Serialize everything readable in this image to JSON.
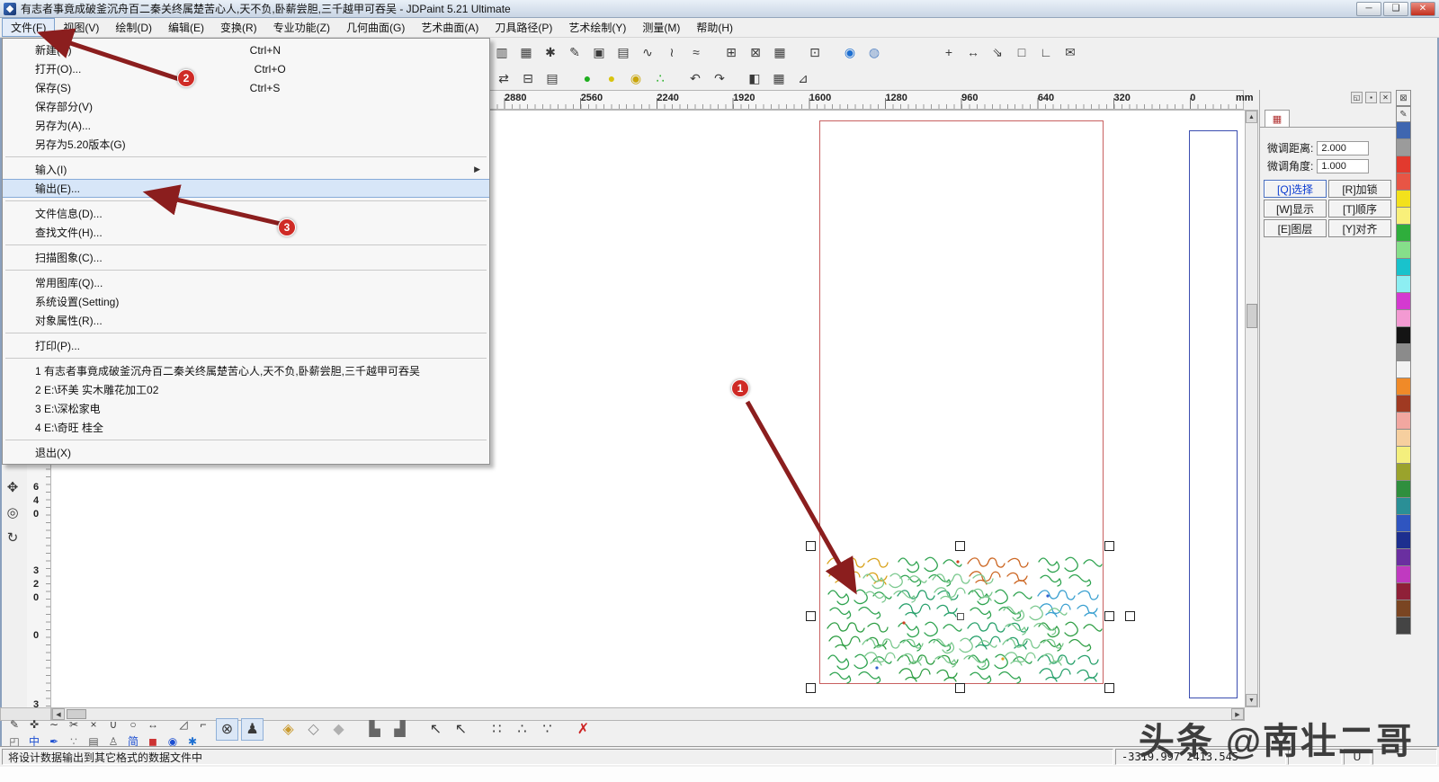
{
  "window": {
    "title": "有志者事竟成破釜沉舟百二秦关终属楚苦心人,天不负,卧薪尝胆,三千越甲可吞吴 - JDPaint 5.21 Ultimate",
    "min_glyph": "─",
    "max_glyph": "❑",
    "close_glyph": "✕"
  },
  "menu_bar": {
    "items": [
      {
        "label": "文件(F)",
        "cls": "open",
        "name": "menubar-item-file"
      },
      {
        "label": "视图(V)",
        "name": "menubar-item-view"
      },
      {
        "label": "绘制(D)",
        "name": "menubar-item-draw"
      },
      {
        "label": "编辑(E)",
        "name": "menubar-item-edit"
      },
      {
        "label": "变换(R)",
        "name": "menubar-item-transform"
      },
      {
        "label": "专业功能(Z)",
        "name": "menubar-item-pro-functions"
      },
      {
        "label": "几何曲面(G)",
        "name": "menubar-item-geometric-surface"
      },
      {
        "label": "艺术曲面(A)",
        "name": "menubar-item-art-surface"
      },
      {
        "label": "刀具路径(P)",
        "name": "menubar-item-toolpath"
      },
      {
        "label": "艺术绘制(Y)",
        "name": "menubar-item-art-draw"
      },
      {
        "label": "测量(M)",
        "name": "menubar-item-measure"
      },
      {
        "label": "帮助(H)",
        "name": "menubar-item-help"
      }
    ]
  },
  "file_menu": {
    "items": [
      {
        "label": "新建(N)",
        "shortcut": "Ctrl+N",
        "name": "file-menu-new"
      },
      {
        "label": "打开(O)...",
        "shortcut": "Ctrl+O",
        "name": "file-menu-open"
      },
      {
        "label": "保存(S)",
        "shortcut": "Ctrl+S",
        "name": "file-menu-save"
      },
      {
        "label": "保存部分(V)",
        "name": "file-menu-save-part"
      },
      {
        "label": "另存为(A)...",
        "name": "file-menu-save-as"
      },
      {
        "label": "另存为5.20版本(G)",
        "name": "file-menu-save-as-520"
      },
      {
        "cls": "sep"
      },
      {
        "label": "输入(I)",
        "arrow": "▶",
        "name": "file-menu-import"
      },
      {
        "label": "输出(E)...",
        "cls": "hl",
        "name": "file-menu-export"
      },
      {
        "cls": "sep"
      },
      {
        "label": "文件信息(D)...",
        "name": "file-menu-file-info"
      },
      {
        "label": "查找文件(H)...",
        "name": "file-menu-find-file"
      },
      {
        "cls": "sep"
      },
      {
        "label": "扫描图象(C)...",
        "name": "file-menu-scan-image"
      },
      {
        "cls": "sep"
      },
      {
        "label": "常用图库(Q)...",
        "name": "file-menu-clipart-library"
      },
      {
        "label": "系统设置(Setting)",
        "name": "file-menu-system-settings"
      },
      {
        "label": "对象属性(R)...",
        "name": "file-menu-object-properties"
      },
      {
        "cls": "sep"
      },
      {
        "label": "打印(P)...",
        "name": "file-menu-print"
      },
      {
        "cls": "sep"
      },
      {
        "label": "1 有志者事竟成破釜沉舟百二秦关终属楚苦心人,天不负,卧薪尝胆,三千越甲可吞吴",
        "name": "file-menu-recent-1"
      },
      {
        "label": "2 E:\\环美  实木雕花加工02",
        "name": "file-menu-recent-2"
      },
      {
        "label": "3 E:\\深松家电",
        "name": "file-menu-recent-3"
      },
      {
        "label": "4 E:\\奇旺 桂全",
        "name": "file-menu-recent-4"
      },
      {
        "cls": "sep"
      },
      {
        "label": "退出(X)",
        "name": "file-menu-exit"
      }
    ]
  },
  "toolbars": {
    "row1": [
      {
        "name": "pattern-tool-icon",
        "glyph": "▥"
      },
      {
        "name": "array-tool-icon",
        "glyph": "▦"
      },
      {
        "name": "settings-gear-icon",
        "glyph": "✱"
      },
      {
        "name": "surface-pen-icon",
        "glyph": "✎"
      },
      {
        "name": "panel-view-icon",
        "glyph": "▣"
      },
      {
        "name": "mesh-grid-icon",
        "glyph": "▤"
      },
      {
        "name": "curve-tool-icon",
        "glyph": "∿"
      },
      {
        "name": "spiral-tool-icon",
        "glyph": "≀"
      },
      {
        "name": "wave-tool-icon",
        "glyph": "≈"
      },
      {
        "name": "grid-plus-icon",
        "glyph": "⊞",
        "cls": "gap"
      },
      {
        "name": "target-grid-icon",
        "glyph": "⊠"
      },
      {
        "name": "cell-table-icon",
        "glyph": "▦"
      },
      {
        "name": "overlay-cells-icon",
        "glyph": "⊡",
        "cls": "gap"
      },
      {
        "name": "blue-sphere-icon",
        "glyph": "◉",
        "color": "#1d6fd1",
        "cls": "gap"
      },
      {
        "name": "shield-icon",
        "glyph": "◍",
        "color": "#5a87c5"
      },
      {
        "name": "crosshair-icon",
        "glyph": "+",
        "cls": "bigGap"
      },
      {
        "name": "measure-width-icon",
        "glyph": "↔"
      },
      {
        "name": "snap-corner-icon",
        "glyph": "⇘"
      },
      {
        "name": "region-select-icon",
        "glyph": "□"
      },
      {
        "name": "angle-tool-icon",
        "glyph": "∟"
      },
      {
        "name": "annotation-balloon-icon",
        "glyph": "✉"
      }
    ],
    "row2": [
      {
        "name": "swap-axes-icon",
        "glyph": "⇄"
      },
      {
        "name": "copy-params-icon",
        "glyph": "⊟"
      },
      {
        "name": "layout-panel-icon",
        "glyph": "▤"
      },
      {
        "name": "render-ball-green-icon",
        "glyph": "●",
        "color": "#1fae1f",
        "cls": "gap"
      },
      {
        "name": "render-ball-yellow-icon",
        "glyph": "●",
        "color": "#d8c410"
      },
      {
        "name": "pick-ball-icon",
        "glyph": "◉",
        "color": "#c9a50a"
      },
      {
        "name": "multi-ball-icon",
        "glyph": "∴",
        "color": "#1fae1f"
      },
      {
        "name": "undo-view-icon",
        "glyph": "↶",
        "cls": "gap"
      },
      {
        "name": "redo-view-icon",
        "glyph": "↷"
      },
      {
        "name": "iso-cube-icon",
        "glyph": "◧",
        "cls": "gap"
      },
      {
        "name": "cube-grid-icon",
        "glyph": "▦"
      },
      {
        "name": "measure-ruler-icon",
        "glyph": "⊿"
      }
    ],
    "bottomA": [
      {
        "name": "pen-node-icon",
        "glyph": "✎"
      },
      {
        "name": "node-edit-icon",
        "glyph": "✜"
      },
      {
        "name": "smooth-curve-icon",
        "glyph": "∼"
      },
      {
        "name": "scissors-icon",
        "glyph": "✂"
      },
      {
        "name": "break-node-icon",
        "glyph": "×"
      },
      {
        "name": "join-curve-icon",
        "glyph": "∪"
      },
      {
        "name": "close-curve-icon",
        "glyph": "○"
      },
      {
        "name": "reverse-curve-icon",
        "glyph": "↔"
      },
      {
        "name": "mirror-tool-icon",
        "glyph": "◿",
        "cls": "gap"
      },
      {
        "name": "corner-tool-icon",
        "glyph": "⌐"
      }
    ],
    "bottomB": [
      {
        "name": "transform-tool-icon",
        "glyph": "◰",
        "color": "#555555"
      },
      {
        "name": "chinese-mode-icon",
        "glyph": "中",
        "color": "#1d4fd1"
      },
      {
        "name": "brush-tool-icon",
        "glyph": "✒",
        "color": "#1d4fd1"
      },
      {
        "name": "dots-tool-icon",
        "glyph": "∵",
        "color": "#777777"
      },
      {
        "name": "keyboard-icon",
        "glyph": "▤",
        "color": "#555555"
      },
      {
        "name": "user-tool-icon",
        "glyph": "♙",
        "color": "#555555"
      },
      {
        "name": "simplified-mode-icon",
        "glyph": "简",
        "color": "#1d4fd1"
      },
      {
        "name": "stamp-red-icon",
        "glyph": "◼",
        "color": "#cc3333"
      },
      {
        "name": "shield-blue-icon",
        "glyph": "◉",
        "color": "#1d4fd1"
      },
      {
        "name": "gear-blue-icon",
        "glyph": "✱",
        "color": "#1d6fd1"
      }
    ],
    "bottomC": [
      {
        "name": "weld-tool-icon",
        "glyph": "⊗",
        "cls": "pressed"
      },
      {
        "name": "art-path-icon",
        "glyph": "♟",
        "cls": "pressed"
      },
      {
        "name": "diamond-corner-icon",
        "glyph": "◈",
        "color": "#c99a2e",
        "cls": "gap"
      },
      {
        "name": "diamond-outline-icon",
        "glyph": "◇",
        "color": "#888888"
      },
      {
        "name": "diamond-fill-icon",
        "glyph": "◆",
        "color": "#b0b0b0"
      },
      {
        "name": "align-steps-left-icon",
        "glyph": "▙",
        "color": "#666666",
        "cls": "gap"
      },
      {
        "name": "align-steps-right-icon",
        "glyph": "▟",
        "color": "#666666"
      },
      {
        "name": "pick-arrow-icon",
        "glyph": "↖",
        "cls": "gap"
      },
      {
        "name": "pick-arrow-plus-icon",
        "glyph": "↖"
      },
      {
        "name": "snap-node-icon",
        "glyph": "∷",
        "cls": "gap"
      },
      {
        "name": "snap-mid-icon",
        "glyph": "∴"
      },
      {
        "name": "snap-grid-icon",
        "glyph": "∵"
      },
      {
        "name": "delete-red-icon",
        "glyph": "✗",
        "color": "#cc2222",
        "cls": "gap"
      }
    ]
  },
  "left_tools": [
    {
      "name": "pan-tool-icon",
      "glyph": "✥"
    },
    {
      "name": "zoom-tool-icon",
      "glyph": "◎"
    },
    {
      "name": "refresh-view-icon",
      "glyph": "↻"
    }
  ],
  "ruler": {
    "labels": [
      "2880",
      "2560",
      "2240",
      "1920",
      "1600",
      "1280",
      "960",
      "640",
      "320",
      "0"
    ],
    "unit": "mm"
  },
  "vruler": [
    "6\n4\n0",
    "3\n2\n0",
    "0",
    "3"
  ],
  "right_panel": {
    "dock": {
      "float_glyph": "◱",
      "pin_glyph": "▪",
      "close_glyph": "✕"
    },
    "tab_icon": "▦",
    "fields": [
      {
        "label": "微调距离:",
        "value": "2.000"
      },
      {
        "label": "微调角度:",
        "value": "1.000"
      }
    ],
    "buttons": [
      {
        "label": "[Q]选择",
        "cls": "active",
        "name": "select-mode-button"
      },
      {
        "label": "[R]加锁",
        "name": "lock-button"
      },
      {
        "label": "[W]显示",
        "name": "display-button"
      },
      {
        "label": "[T]顺序",
        "name": "order-button"
      },
      {
        "label": "[E]图层",
        "name": "layer-button"
      },
      {
        "label": "[Y]对齐",
        "name": "align-button"
      }
    ]
  },
  "palette": {
    "tools": [
      {
        "name": "no-color-icon",
        "glyph": "⊠"
      },
      {
        "name": "stroke-color-icon",
        "glyph": "✎"
      }
    ],
    "colors": [
      "#3f66b0",
      "#9b9b9b",
      "#e23a2e",
      "#e85545",
      "#f3e11c",
      "#f9f07a",
      "#2fae3c",
      "#86df8a",
      "#19c2cc",
      "#8deef2",
      "#d43ad0",
      "#f39ad2",
      "#141414",
      "#8b8b8b",
      "#f2f2f2",
      "#f08a28",
      "#a03a22",
      "#f2a7a0",
      "#f6cf9f",
      "#f4ef7d",
      "#9aa32c",
      "#2f8f3e",
      "#2a8f96",
      "#2f55c0",
      "#1d2f8f",
      "#6a2fa0",
      "#c03ac0",
      "#8f2038",
      "#7a4522",
      "#444444"
    ]
  },
  "scrollbars": {
    "up": "▲",
    "down": "▼",
    "left": "◀",
    "right": "▶"
  },
  "status_bar": {
    "message": "将设计数据输出到其它格式的数据文件中",
    "coordinates": "-3319.997  2413.545",
    "mode": "U"
  },
  "annotations": {
    "step1": "1",
    "step2": "2",
    "step3": "3"
  },
  "watermark": "头条 @南壮二哥",
  "colors": {
    "annotation_red": "#8b1e1e",
    "selection_rect_red": "#c86060",
    "panel_rect_blue": "#3b4db0",
    "menu_highlight": "#d7e6f8",
    "badge_red": "#cf2b26"
  }
}
